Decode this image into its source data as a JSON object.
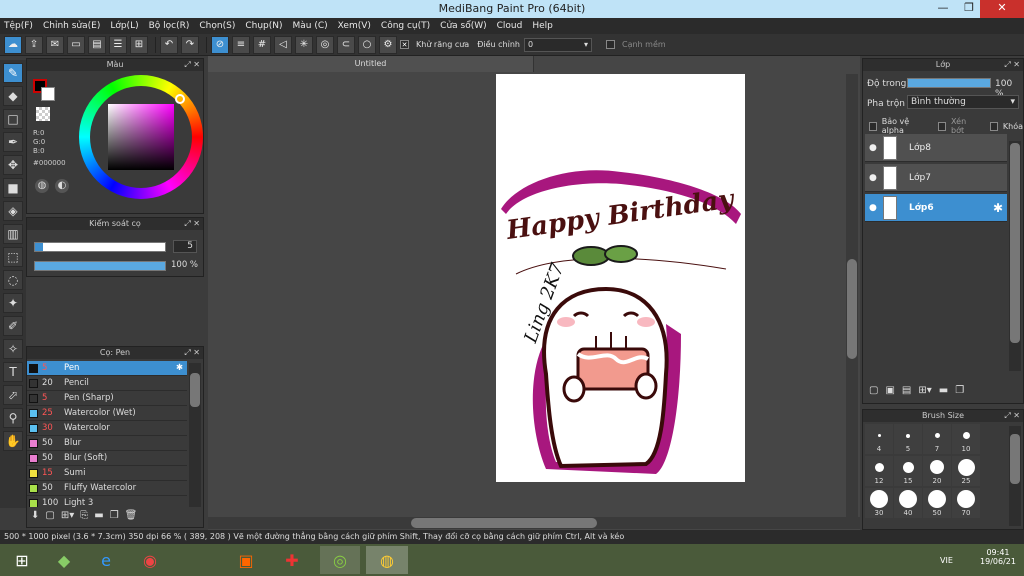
{
  "window": {
    "title": "MediBang Paint Pro (64bit)"
  },
  "menu": [
    "Tệp(F)",
    "Chỉnh sửa(E)",
    "Lớp(L)",
    "Bộ lọc(R)",
    "Chọn(S)",
    "Chụp(N)",
    "Màu (C)",
    "Xem(V)",
    "Công cụ(T)",
    "Cửa sổ(W)",
    "Cloud",
    "Help"
  ],
  "toolbar": {
    "antialias_label": "Khử răng cưa",
    "adjust_label": "Điều chỉnh",
    "adjust_value": "0",
    "edge_label": "Cạnh mềm"
  },
  "color_panel": {
    "title": "Màu",
    "r": "R:0",
    "g": "G:0",
    "b": "B:0",
    "hex": "#000000"
  },
  "brush_control": {
    "title": "Kiểm soát cọ",
    "size": "5",
    "opacity": "100 %",
    "opacity_fraction": 1.0
  },
  "brush_panel": {
    "title": "Cọ: Pen",
    "items": [
      {
        "size": "5",
        "name": "Pen",
        "color": "#3d8fd0"
      },
      {
        "size": "20",
        "name": "Pencil",
        "color": "#333333"
      },
      {
        "size": "5",
        "name": "Pen (Sharp)",
        "color": "#333333"
      },
      {
        "size": "25",
        "name": "Watercolor (Wet)",
        "color": "#5bc0f0"
      },
      {
        "size": "30",
        "name": "Watercolor",
        "color": "#5bc0f0"
      },
      {
        "size": "50",
        "name": "Blur",
        "color": "#e97ed0"
      },
      {
        "size": "50",
        "name": "Blur (Soft)",
        "color": "#e97ed0"
      },
      {
        "size": "15",
        "name": "Sumi",
        "color": "#f0e040"
      },
      {
        "size": "50",
        "name": "Fluffy Watercolor",
        "color": "#a8e04a"
      },
      {
        "size": "100",
        "name": "Light 3",
        "color": "#a8e04a"
      }
    ]
  },
  "document": {
    "tab_title": "Untitled",
    "card_top_text": "Happy Birthday",
    "card_signature": "Ling 2K7"
  },
  "layers_panel": {
    "title": "Lớp",
    "opacity_label": "Độ trong",
    "opacity_value": "100 %",
    "blend_label": "Pha trộn",
    "blend_value": "Bình thường",
    "protect_alpha": "Bảo vệ alpha",
    "clipping": "Xén bớt",
    "lock": "Khóa",
    "layers": [
      {
        "name": "Lớp8"
      },
      {
        "name": "Lớp7"
      },
      {
        "name": "Lớp6"
      }
    ]
  },
  "brush_size_panel": {
    "title": "Brush Size",
    "sizes": [
      "4",
      "5",
      "7",
      "10",
      "12",
      "15",
      "20",
      "25",
      "30",
      "40",
      "50",
      "70"
    ]
  },
  "status": {
    "text": "500 * 1000 pixel   (3.6 * 7.3cm)   350 dpi   66 %   ( 389, 208 )   Vẽ một đường thẳng bằng cách giữ phím Shift, Thay đổi cỡ cọ bằng cách giữ phím Ctrl, Alt và kéo"
  },
  "taskbar": {
    "lang": "VIE",
    "time": "09:41",
    "date": "19/06/21"
  }
}
